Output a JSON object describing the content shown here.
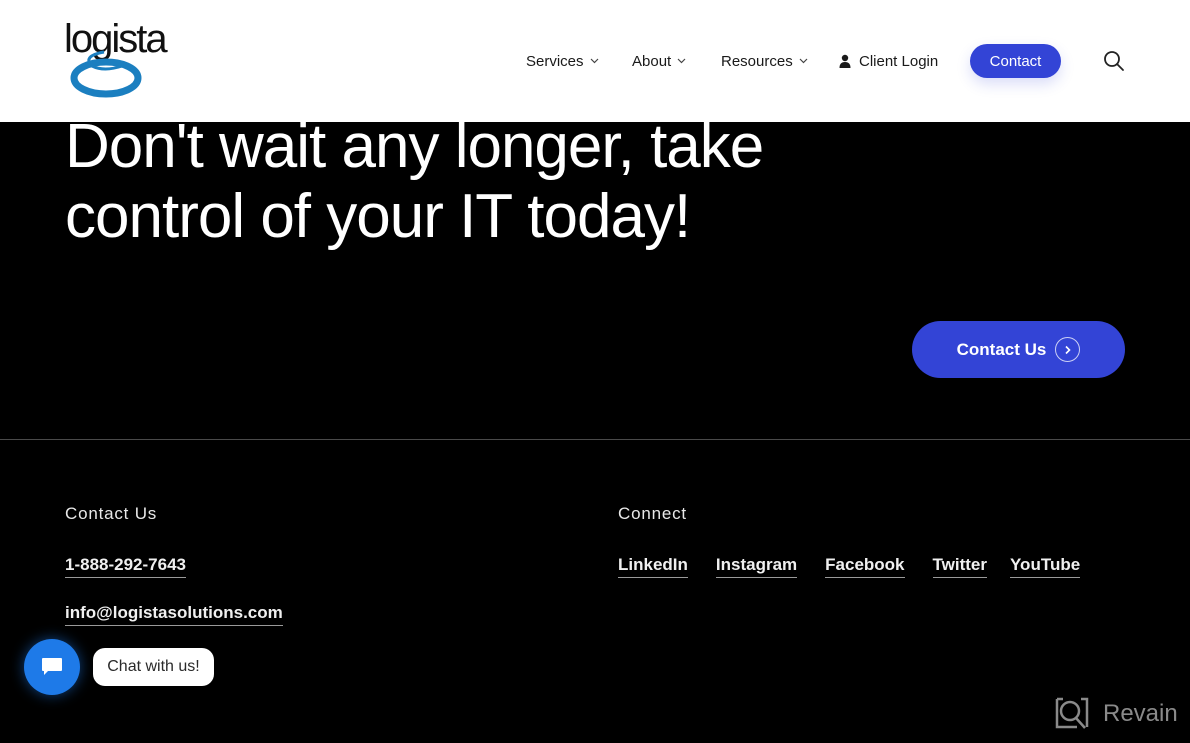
{
  "header": {
    "logo_text": "logista",
    "nav": [
      {
        "label": "Services",
        "has_dropdown": true
      },
      {
        "label": "About",
        "has_dropdown": true
      },
      {
        "label": "Resources",
        "has_dropdown": true
      }
    ],
    "client_login": {
      "label": "Client Login",
      "icon": "person-icon"
    },
    "contact_button": "Contact",
    "search_icon": "search-icon"
  },
  "hero": {
    "title": "Don't wait any longer, take control of your IT today!",
    "cta_label": "Contact Us",
    "cta_icon": "chevron-right-circle-icon"
  },
  "footer": {
    "contact": {
      "heading": "Contact Us",
      "phone": "1-888-292-7643",
      "email": "info@logistasolutions.com"
    },
    "connect": {
      "heading": "Connect",
      "links": [
        "LinkedIn",
        "Instagram",
        "Facebook",
        "Twitter",
        "YouTube"
      ]
    }
  },
  "chat": {
    "label": "Chat with us!",
    "icon": "chat-icon"
  },
  "watermark": {
    "text": "Revain"
  },
  "colors": {
    "accent": "#3344d6",
    "chat_blue": "#1e7ae8",
    "logo_blue": "#1b7fc0",
    "background": "#000000",
    "header_bg": "#ffffff"
  }
}
